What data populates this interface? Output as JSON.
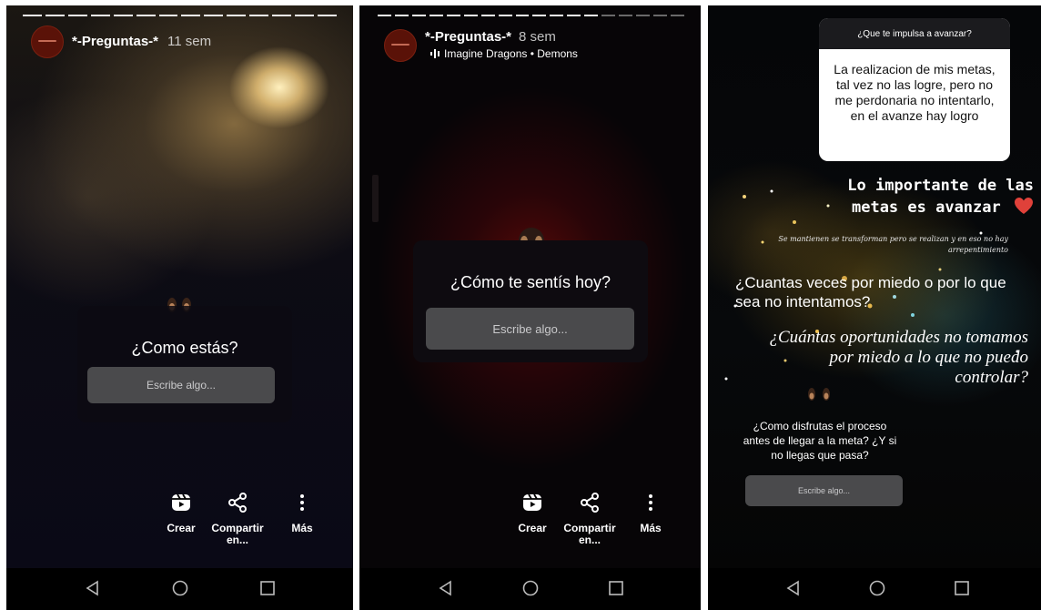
{
  "screens": [
    {
      "username": "*-Preguntas-*",
      "time": "11 sem",
      "question": "¿Como estás?",
      "placeholder": "Escribe algo...",
      "actions": {
        "create": "Crear",
        "share_line1": "Compartir",
        "share_line2": "en...",
        "more": "Más"
      }
    },
    {
      "username": "*-Preguntas-*",
      "time": "8 sem",
      "music_label": "Imagine Dragons • Demons",
      "question": "¿Cómo te sentís hoy?",
      "placeholder": "Escribe algo...",
      "actions": {
        "create": "Crear",
        "share_line1": "Compartir",
        "share_line2": "en...",
        "more": "Más"
      }
    },
    {
      "answer_header": "¿Que te impulsa a avanzar?",
      "answer_body": "La realizacion de mis metas, tal vez no las logre, pero no me perdonaria no intentarlo, en el avanze hay logro",
      "headline_line1": "Lo importante de las",
      "headline_line2": "metas es avanzar",
      "script_text": "Se mantienen se transforman pero se realizan y en eso no hay arrepentimiento",
      "text_block_1": "¿Cuantas veces por miedo o por lo que sea no intentamos?",
      "text_block_2": "¿Cuántas oportunidades no tomamos por miedo a lo que no puedo controlar?",
      "question": "¿Como disfrutas el proceso antes de llegar a la meta? ¿Y si no llegas que pasa?",
      "placeholder": "Escribe algo..."
    }
  ],
  "colors": {
    "accent_heart": "#e0413a",
    "input_bg": "#4a4a4c",
    "card_bg": "#0f0c12"
  },
  "icons": [
    "reels-icon",
    "share-icon",
    "more-icon",
    "back-icon",
    "home-icon",
    "recents-icon",
    "music-bars-icon",
    "heart-icon"
  ]
}
